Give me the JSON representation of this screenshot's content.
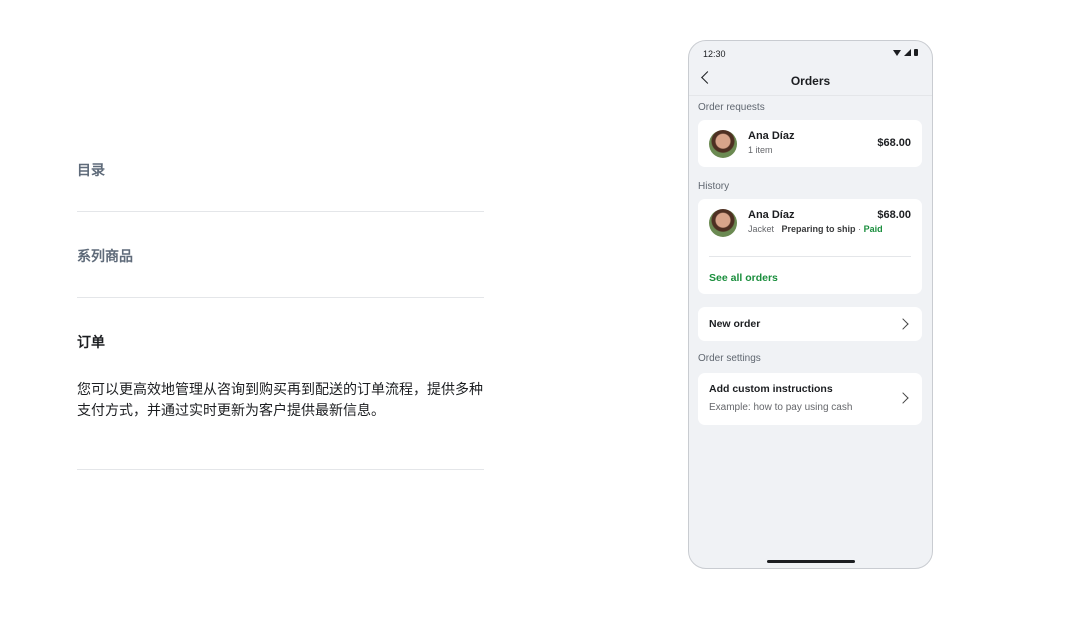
{
  "accordion": {
    "items": [
      {
        "title": "目录"
      },
      {
        "title": "系列商品"
      },
      {
        "title": "订单",
        "body": "您可以更高效地管理从咨询到购买再到配送的订单流程，提供多种支付方式，并通过实时更新为客户提供最新信息。"
      }
    ]
  },
  "phone": {
    "status_time": "12:30",
    "nav_title": "Orders",
    "requests": {
      "label": "Order requests",
      "name": "Ana Díaz",
      "sub": "1 item",
      "price": "$68.00"
    },
    "history": {
      "label": "History",
      "name": "Ana Díaz",
      "item": "Jacket",
      "status": "Preparing to ship",
      "separator": "·",
      "payment": "Paid",
      "price": "$68.00",
      "see_all": "See all orders"
    },
    "new_order": "New order",
    "settings": {
      "label": "Order settings",
      "title": "Add custom instructions",
      "sub": "Example: how to pay using cash"
    }
  },
  "colors": {
    "accent_green": "#1a8e3d",
    "background": "#f0f2f5"
  }
}
